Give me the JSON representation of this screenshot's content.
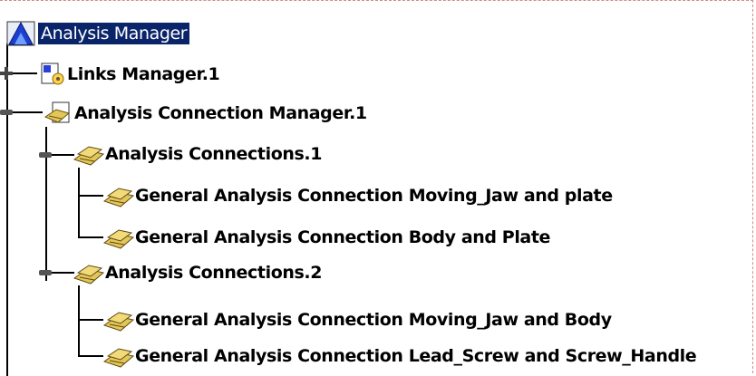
{
  "tree": {
    "root": {
      "label": "Analysis Manager",
      "selected": true,
      "icon": "analysis-manager-icon"
    },
    "links_manager": {
      "label": "Links Manager.1",
      "icon": "links-manager-icon",
      "expanded": false
    },
    "connection_manager": {
      "label": "Analysis Connection Manager.1",
      "icon": "connection-manager-icon",
      "expanded": true
    },
    "connections_1": {
      "label": "Analysis Connections.1",
      "icon": "connection-set-icon",
      "expanded": true,
      "children": [
        {
          "label": "General Analysis Connection Moving_Jaw and plate",
          "icon": "general-connection-icon"
        },
        {
          "label": "General Analysis Connection Body and Plate",
          "icon": "general-connection-icon"
        }
      ]
    },
    "connections_2": {
      "label": "Analysis Connections.2",
      "icon": "connection-set-icon",
      "expanded": true,
      "children": [
        {
          "label": "General Analysis Connection Moving_Jaw and Body",
          "icon": "general-connection-icon"
        },
        {
          "label": "General Analysis Connection Lead_Screw and Screw_Handle",
          "icon": "general-connection-icon"
        }
      ]
    }
  },
  "colors": {
    "selection": "#0a246a",
    "connector": "#000000",
    "folder": "#d8b84a"
  }
}
